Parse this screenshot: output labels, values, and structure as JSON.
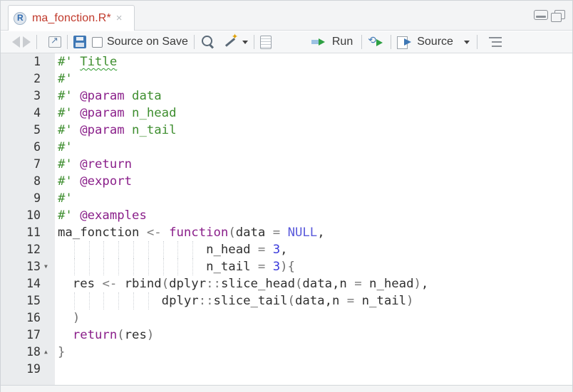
{
  "tab": {
    "title": "ma_fonction.R*",
    "close": "×"
  },
  "toolbar": {
    "source_on_save": "Source on Save",
    "run": "Run",
    "source": "Source"
  },
  "editor": {
    "lines": [
      {
        "n": "1",
        "html": "<span class=\"c-com\">#' <span class=\"spell\">Title</span></span>"
      },
      {
        "n": "2",
        "html": "<span class=\"c-com\">#'</span>"
      },
      {
        "n": "3",
        "html": "<span class=\"c-com\">#' </span><span class=\"c-tag\">@param</span><span class=\"c-com\"> data</span>"
      },
      {
        "n": "4",
        "html": "<span class=\"c-com\">#' </span><span class=\"c-tag\">@param</span><span class=\"c-com\"> n_head</span>"
      },
      {
        "n": "5",
        "html": "<span class=\"c-com\">#' </span><span class=\"c-tag\">@param</span><span class=\"c-com\"> n_tail</span>"
      },
      {
        "n": "6",
        "html": "<span class=\"c-com\">#'</span>"
      },
      {
        "n": "7",
        "html": "<span class=\"c-com\">#' </span><span class=\"c-tag\">@return</span>"
      },
      {
        "n": "8",
        "html": "<span class=\"c-com\">#' </span><span class=\"c-tag\">@export</span>"
      },
      {
        "n": "9",
        "html": "<span class=\"c-com\">#'</span>"
      },
      {
        "n": "10",
        "html": "<span class=\"c-com\">#' </span><span class=\"c-tag\">@examples</span>"
      },
      {
        "n": "11",
        "html": "ma_fonction <span class=\"c-op\">&lt;-</span> <span class=\"c-kw\">function</span><span class=\"c-paren\">(</span>data <span class=\"c-op\">=</span> <span class=\"c-nul\">NULL</span>,"
      },
      {
        "n": "12",
        "html": "                    n_head <span class=\"c-op\">=</span> <span class=\"c-num\">3</span>,"
      },
      {
        "n": "13",
        "fold": "down",
        "html": "                    n_tail <span class=\"c-op\">=</span> <span class=\"c-num\">3</span><span class=\"c-paren\">)</span><span class=\"c-paren\">{</span>"
      },
      {
        "n": "14",
        "html": "  res <span class=\"c-op\">&lt;-</span> rbind<span class=\"c-paren\">(</span>dplyr<span class=\"c-op\">::</span>slice_head<span class=\"c-paren\">(</span>data,n <span class=\"c-op\">=</span> n_head<span class=\"c-paren\">)</span>,"
      },
      {
        "n": "15",
        "html": "              dplyr<span class=\"c-op\">::</span>slice_tail<span class=\"c-paren\">(</span>data,n <span class=\"c-op\">=</span> n_tail<span class=\"c-paren\">)</span>"
      },
      {
        "n": "16",
        "html": "  <span class=\"c-paren\">)</span>"
      },
      {
        "n": "17",
        "html": "  <span class=\"c-kw\">return</span><span class=\"c-paren\">(</span>res<span class=\"c-paren\">)</span>"
      },
      {
        "n": "18",
        "fold": "up",
        "html": "<span class=\"c-paren\">}</span>"
      },
      {
        "n": "19",
        "html": ""
      }
    ]
  }
}
